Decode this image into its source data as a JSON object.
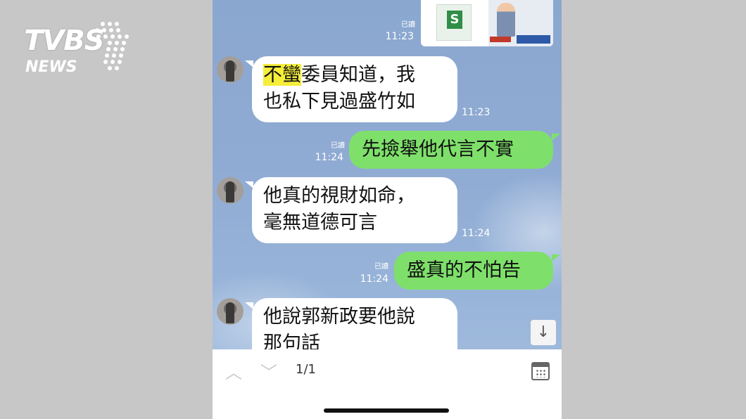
{
  "logo": {
    "main": "TVBS",
    "sub": "NEWS"
  },
  "chat": {
    "top_read": "已讀",
    "top_time": "11:23",
    "messages": [
      {
        "dir": "in",
        "line1_hl": "不蠻",
        "line1_rest": "委員知道，我",
        "line2": "也私下見過盛竹如",
        "time": "11:23"
      },
      {
        "dir": "out",
        "read": "已讀",
        "time": "11:24",
        "text": "先撿舉他代言不實"
      },
      {
        "dir": "in",
        "line1": "他真的視財如命，",
        "line2": "毫無道德可言",
        "time": "11:24"
      },
      {
        "dir": "out",
        "read": "已讀",
        "time": "11:24",
        "text": "盛真的不怕告"
      },
      {
        "dir": "in",
        "line1": "他說郭新政要他說",
        "line2": "那句話"
      }
    ]
  },
  "toolbar": {
    "page_indicator": "1/1"
  },
  "icons": {
    "scroll_down": "↓",
    "prev": "︿",
    "next": "﹀"
  },
  "colors": {
    "outgoing_bubble": "#7ee06a",
    "chat_bg": "#90abd3",
    "highlight": "#f5ee3a"
  }
}
